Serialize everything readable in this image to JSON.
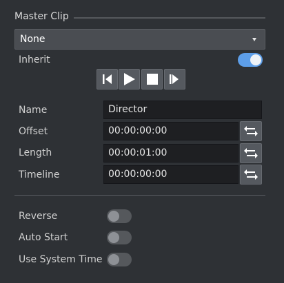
{
  "section": {
    "title": "Master Clip"
  },
  "dropdown": {
    "value": "None"
  },
  "inherit": {
    "label": "Inherit",
    "on": true
  },
  "transport": {
    "buttons": [
      "go-to-start-icon",
      "play-icon",
      "stop-icon",
      "go-to-end-icon"
    ]
  },
  "fields": {
    "name": {
      "label": "Name",
      "value": "Director"
    },
    "offset": {
      "label": "Offset",
      "value": "00:00:00:00"
    },
    "length": {
      "label": "Length",
      "value": "00:00:01:00"
    },
    "timeline": {
      "label": "Timeline",
      "value": "00:00:00:00"
    }
  },
  "options": {
    "reverse": {
      "label": "Reverse",
      "on": false
    },
    "auto_start": {
      "label": "Auto Start",
      "on": false
    },
    "use_system_time": {
      "label": "Use System Time",
      "on": false
    }
  },
  "colors": {
    "background": "#2e3135",
    "accent": "#5d9ee8",
    "field_bg": "#1e1f22"
  }
}
